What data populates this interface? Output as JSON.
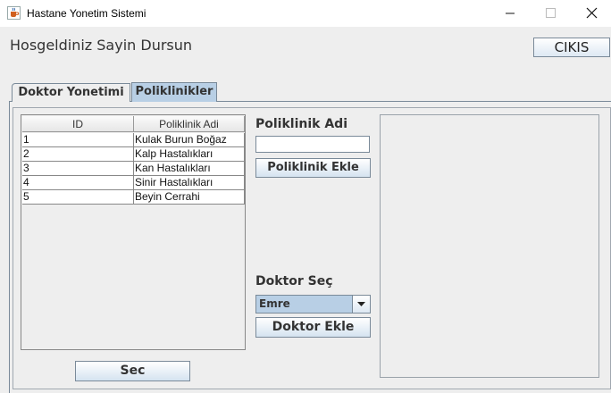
{
  "window": {
    "title": "Hastane Yonetim Sistemi",
    "icon": "java-cup-icon"
  },
  "header": {
    "welcome": "Hosgeldiniz Sayin Dursun",
    "exit_label": "CIKIS"
  },
  "tabs": [
    {
      "label": "Doktor Yonetimi",
      "selected": false
    },
    {
      "label": "Poliklinikler",
      "selected": true
    }
  ],
  "table": {
    "columns": [
      "ID",
      "Poliklinik Adi"
    ],
    "rows": [
      {
        "id": "1",
        "name": "Kulak Burun Boğaz"
      },
      {
        "id": "2",
        "name": "Kalp Hastalıkları"
      },
      {
        "id": "3",
        "name": "Kan Hastalıkları"
      },
      {
        "id": "4",
        "name": "Sinir Hastalıkları"
      },
      {
        "id": "5",
        "name": "Beyin Cerrahi"
      }
    ]
  },
  "form": {
    "poliklinik_label": "Poliklinik Adi",
    "poliklinik_value": "",
    "poliklinik_ekle": "Poliklinik Ekle",
    "doktor_label": "Doktor Seç",
    "doktor_selected": "Emre",
    "doktor_ekle": "Doktor Ekle",
    "sec_label": "Sec"
  },
  "colors": {
    "selected_tab": "#b8cfe5",
    "background": "#eeeeee",
    "border": "#7a8a99"
  }
}
